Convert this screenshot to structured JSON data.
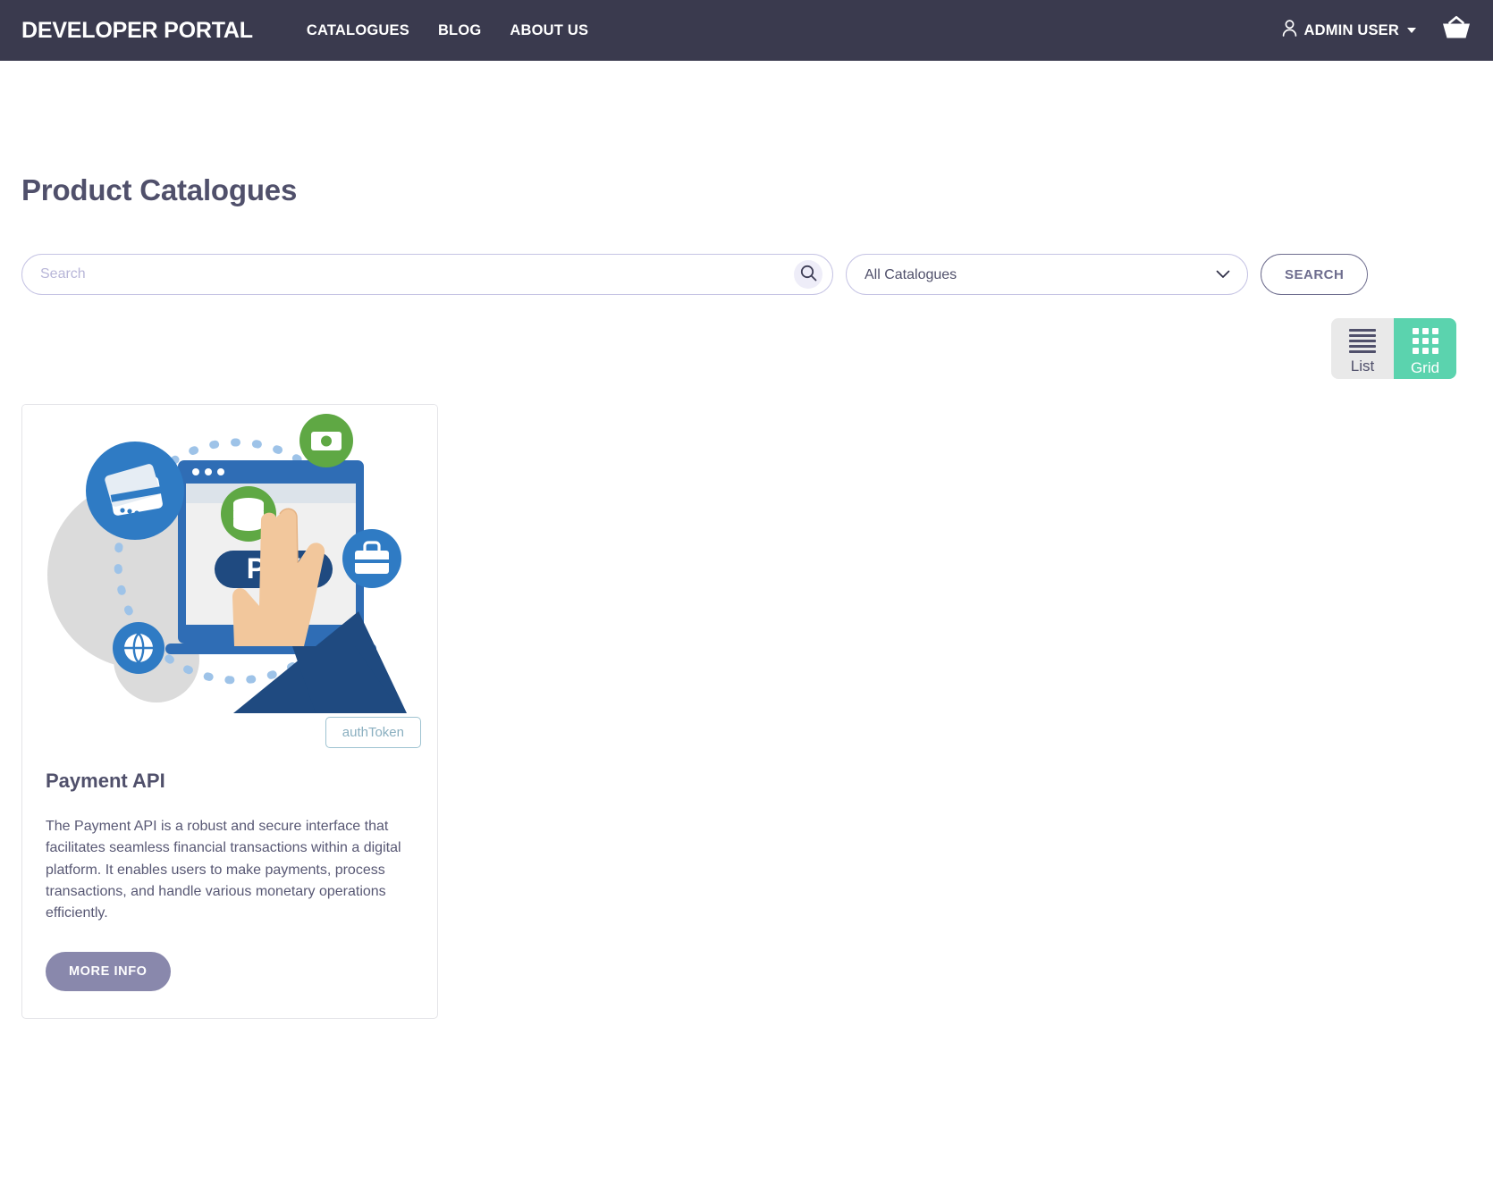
{
  "navbar": {
    "brand": "DEVELOPER PORTAL",
    "links": [
      {
        "label": "CATALOGUES"
      },
      {
        "label": "BLOG"
      },
      {
        "label": "ABOUT US"
      }
    ],
    "user": {
      "label": "ADMIN USER",
      "icon": "person-icon",
      "caret": "chevron-down-icon"
    },
    "cart": {
      "icon": "shopping-basket-icon"
    },
    "bg_color": "#3A3A4E"
  },
  "page": {
    "title": "Product Catalogues"
  },
  "search": {
    "placeholder": "Search",
    "value": "",
    "icon": "search-icon",
    "catalogue_select": {
      "selected": "All Catalogues",
      "options": [
        "All Catalogues"
      ],
      "chevron": "chevron-down-icon"
    },
    "button_label": "SEARCH"
  },
  "view_toggle": {
    "active": "Grid",
    "options": [
      {
        "label": "List",
        "icon": "list-lines-icon",
        "active": false
      },
      {
        "label": "Grid",
        "icon": "grid-dots-icon",
        "active": true
      }
    ],
    "active_color": "#5BD3AE",
    "inactive_color": "#E9E9E9"
  },
  "products": [
    {
      "image_alt": "payment-api-illustration",
      "badge": "authToken",
      "title": "Payment API",
      "description": "The Payment API is a robust and secure interface that facilitates seamless financial transactions within a digital platform. It enables users to make payments, process transactions, and handle various monetary operations efficiently.",
      "button_label": "MORE INFO"
    }
  ]
}
